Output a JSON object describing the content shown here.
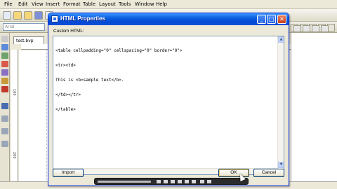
{
  "menubar": {
    "items": [
      "File",
      "Edit",
      "View",
      "Insert",
      "Format",
      "Table",
      "Layout",
      "Tools",
      "Window",
      "Help"
    ]
  },
  "toolbar": {
    "font_value": "Arial"
  },
  "document": {
    "tab_label": "test.bvp",
    "ruler_marks": [
      "100",
      "200"
    ]
  },
  "dialog": {
    "title": "HTML Properties",
    "custom_label": "Custom HTML:",
    "code_lines": [
      "<table cellpadding=\"0\" cellspacing=\"0\" border=\"0\">",
      "<tr><td>",
      "This is <b>sample text</b>.",
      "</td></tr>",
      "</table>"
    ],
    "import_label": "Import",
    "ok_label": "OK",
    "cancel_label": "Cancel",
    "minimize_symbol": "_",
    "maximize_symbol": "□",
    "close_symbol": "✕",
    "scroll_up": "▲",
    "scroll_down": "▼",
    "scroll_left": "◀",
    "scroll_right": "▶"
  },
  "colors": {
    "titlebar": "#0548d3",
    "close_button": "#c7401e",
    "dialog_bg": "#ece9d8"
  }
}
